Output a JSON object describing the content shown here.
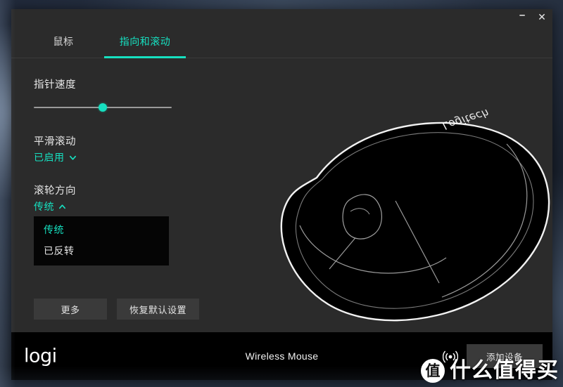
{
  "window": {
    "controls": {
      "minimize_label": "–",
      "minimize_icon": "minimize-icon",
      "close_label": "✕",
      "close_icon": "close-icon"
    }
  },
  "tabs": [
    {
      "label": "鼠标",
      "active": false
    },
    {
      "label": "指向和滚动",
      "active": true
    }
  ],
  "settings": {
    "pointer_speed": {
      "title": "指针速度",
      "value_percent": 50
    },
    "smooth_scroll": {
      "label": "平滑滚动",
      "value": "已启用",
      "chevron": "chevron-down-icon",
      "expanded": false
    },
    "scroll_direction": {
      "label": "滚轮方向",
      "value": "传统",
      "chevron": "chevron-up-icon",
      "expanded": true,
      "options": [
        {
          "label": "传统",
          "selected": true
        },
        {
          "label": "已反转",
          "selected": false
        }
      ]
    }
  },
  "actions": {
    "more_label": "更多",
    "restore_defaults_label": "恢复默认设置"
  },
  "device_art": {
    "name": "wireless-mouse-illustration",
    "brand_mark": "logitech"
  },
  "footer": {
    "logo_text": "logi",
    "device_name": "Wireless Mouse",
    "wireless_icon": "wireless-signal-icon",
    "add_device_label": "添加设备"
  },
  "watermark": {
    "badge": "值",
    "text": "什么值得买"
  },
  "colors": {
    "accent": "#16e0c0",
    "window_bg": "#2b2b2b",
    "footer_bg": "#000000",
    "button_bg": "#3a3a3a",
    "dropdown_bg": "#050505",
    "text_primary": "#e6e6e6"
  }
}
